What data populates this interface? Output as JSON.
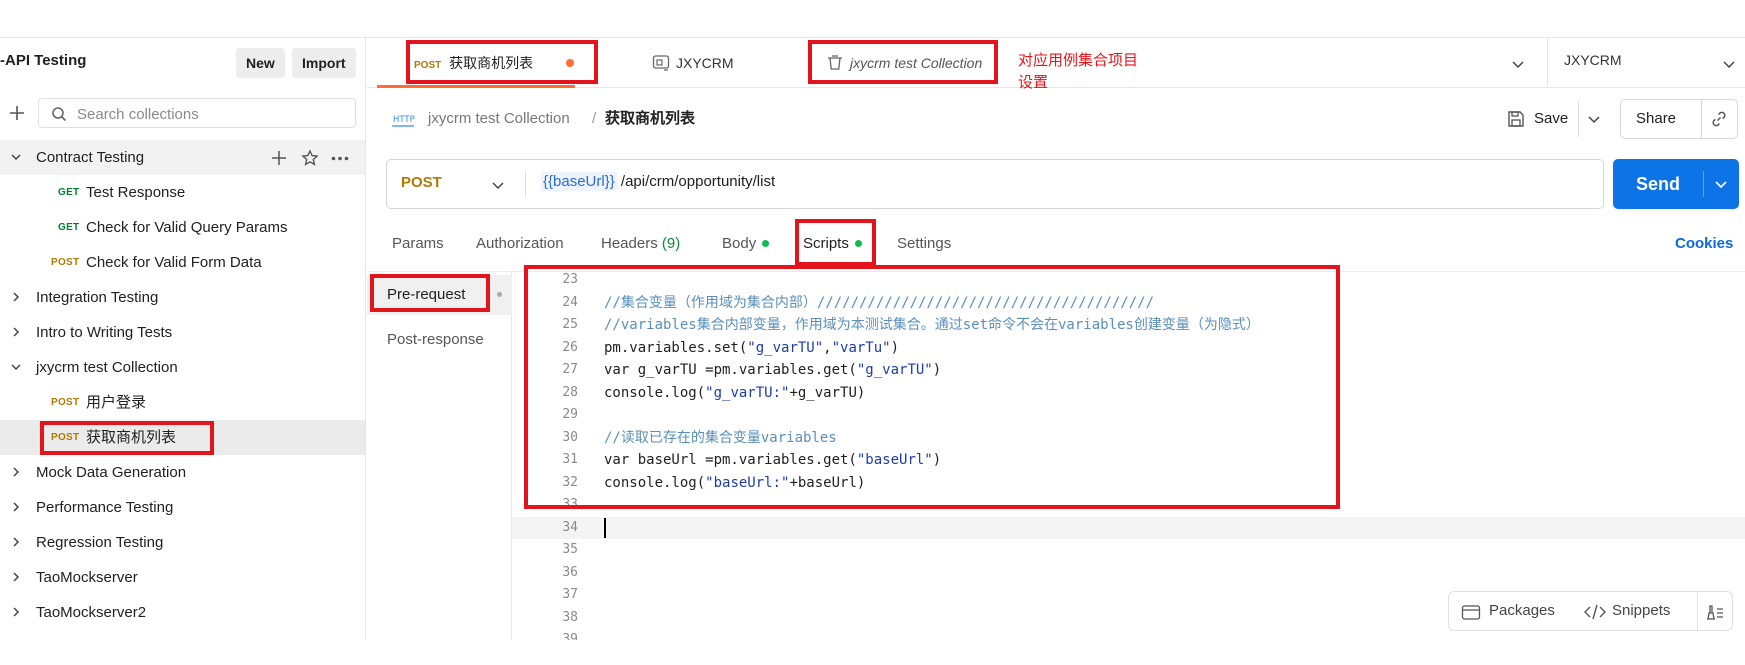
{
  "workspace": {
    "title": "-API Testing",
    "new_label": "New",
    "import_label": "Import"
  },
  "sidebar": {
    "search_placeholder": "Search collections",
    "items": [
      {
        "label": "Contract Testing"
      },
      {
        "method": "GET",
        "label": "Test Response"
      },
      {
        "method": "GET",
        "label": "Check for Valid Query Params"
      },
      {
        "method": "POST",
        "label": "Check for Valid Form Data"
      },
      {
        "label": "Integration Testing"
      },
      {
        "label": "Intro to Writing Tests"
      },
      {
        "label": "jxycrm test Collection"
      },
      {
        "method": "POST",
        "label": "用户登录"
      },
      {
        "method": "POST",
        "label": "获取商机列表"
      },
      {
        "label": "Mock Data Generation"
      },
      {
        "label": "Performance Testing"
      },
      {
        "label": "Regression Testing"
      },
      {
        "label": "TaoMockserver"
      },
      {
        "label": "TaoMockserver2"
      }
    ]
  },
  "tabs": [
    {
      "method": "POST",
      "label": "获取商机列表"
    },
    {
      "label": "JXYCRM"
    },
    {
      "label": "jxycrm test Collection"
    }
  ],
  "annotation": {
    "line1": "对应用例集合项目",
    "line2": "设置"
  },
  "environment": {
    "selected": "JXYCRM"
  },
  "breadcrumb": {
    "badge": "HTTP",
    "collection": "jxycrm test Collection",
    "separator": "/",
    "request": "获取商机列表"
  },
  "toolbar": {
    "save_label": "Save",
    "share_label": "Share"
  },
  "request": {
    "method": "POST",
    "url_var": "{{baseUrl}}",
    "url_path": " /api/crm/opportunity/list",
    "send_label": "Send"
  },
  "request_tabs": {
    "params": "Params",
    "authorization": "Authorization",
    "headers": "Headers",
    "headers_count": "(9)",
    "body": "Body",
    "scripts": "Scripts",
    "settings": "Settings",
    "cookies": "Cookies"
  },
  "script_tabs": {
    "pre_request": "Pre-request",
    "post_response": "Post-response"
  },
  "code": {
    "line_numbers": [
      "23",
      "24",
      "25",
      "26",
      "27",
      "28",
      "29",
      "30",
      "31",
      "32",
      "33",
      "34",
      "35",
      "36",
      "37",
      "38",
      "39"
    ],
    "l24": "//集合变量（作用域为集合内部）////////////////////////////////////////",
    "l25": "//variables集合内部变量，作用域为本测试集合。通过set命令不会在variables创建变量（为隐式）",
    "l26_a": "pm.variables.set(",
    "l26_b": "\"g_varTU\"",
    "l26_c": ",",
    "l26_d": "\"varTu\"",
    "l26_e": ")",
    "l27_a": "var g_varTU =pm.variables.get(",
    "l27_b": "\"g_varTU\"",
    "l27_c": ")",
    "l28_a": "console.log(",
    "l28_b": "\"g_varTU:\"",
    "l28_c": "+g_varTU)",
    "l30": "//读取已存在的集合变量variables",
    "l31_a": "var baseUrl =pm.variables.get(",
    "l31_b": "\"baseUrl\"",
    "l31_c": ")",
    "l32_a": "console.log(",
    "l32_b": "\"baseUrl:\"",
    "l32_c": "+baseUrl)"
  },
  "bottom_bar": {
    "packages": "Packages",
    "snippets": "Snippets"
  },
  "colors": {
    "accent": "#0c74e6",
    "annotation_red": "#e3141b",
    "post": "#ad7a03",
    "get": "#007f31",
    "dirty_dot": "#ff6c37",
    "status_dot": "#0cbb52"
  }
}
